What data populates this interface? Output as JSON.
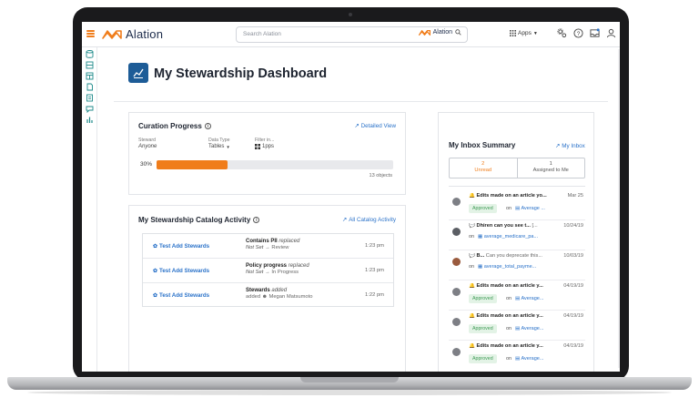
{
  "app": {
    "brand": "Alation"
  },
  "search": {
    "placeholder": "Search Alation",
    "brand": "Alation"
  },
  "topbar": {
    "apps_label": "Apps"
  },
  "page": {
    "title": "My Stewardship Dashboard"
  },
  "curation": {
    "title": "Curation Progress",
    "link": "Detailed View",
    "steward_label": "Steward",
    "steward_value": "Anyone",
    "datatype_label": "Data Type",
    "datatype_value": "Tables",
    "filter_label": "Filter in...",
    "filter_value": "1pps",
    "progress_label": "30%",
    "progress_fraction": 0.3,
    "objects": "13 objects"
  },
  "activity": {
    "title": "My Stewardship Catalog Activity",
    "link": "All Catalog Activity",
    "rows": [
      {
        "action": "Test Add Stewards",
        "field": "Contains PII",
        "verb": "replaced",
        "sub_from": "Not Set",
        "sub_to": "Review",
        "time": "1:23 pm"
      },
      {
        "action": "Test Add Stewards",
        "field": "Policy progress",
        "verb": "replaced",
        "sub_from": "Not Set",
        "sub_to": "In Progress",
        "time": "1:23 pm"
      },
      {
        "action": "Test Add Stewards",
        "field": "Stewards",
        "verb": "added",
        "sub_from": "added",
        "sub_to": "Megan Matsumoto",
        "time": "1:22 pm"
      }
    ]
  },
  "inbox": {
    "title": "My Inbox Summary",
    "link": "My Inbox",
    "tab_unread_count": "2",
    "tab_unread_label": "Unread",
    "tab_assigned_count": "1",
    "tab_assigned_label": "Assigned to Me",
    "messages": [
      {
        "title": "Edits made on an article yo...",
        "date": "Mar 25",
        "status": "Approved",
        "on": "on",
        "link": "Average ...",
        "kind": "bell"
      },
      {
        "title": "Dhiren can you see t...",
        "title_extra": "[...",
        "date": "10/24/19",
        "on": "on",
        "link": "average_medicare_pa...",
        "kind": "chat"
      },
      {
        "title": "B...",
        "title_extra": "Can you deprecate this...",
        "date": "10/03/19",
        "on": "on",
        "link": "average_total_payme...",
        "kind": "chat"
      },
      {
        "title": "Edits made on an article y...",
        "date": "04/19/19",
        "status": "Approved",
        "on": "on",
        "link": "Average...",
        "kind": "bell"
      },
      {
        "title": "Edits made on an article y...",
        "date": "04/19/19",
        "status": "Approved",
        "on": "on",
        "link": "Average...",
        "kind": "bell"
      },
      {
        "title": "Edits made on an article y...",
        "date": "04/19/19",
        "status": "Approved",
        "on": "on",
        "link": "Average...",
        "kind": "bell"
      }
    ]
  },
  "colors": {
    "accent": "#f07d1b",
    "brand_blue": "#1d5c97",
    "link": "#2a72c9",
    "approved_bg": "#e3f3e6"
  }
}
